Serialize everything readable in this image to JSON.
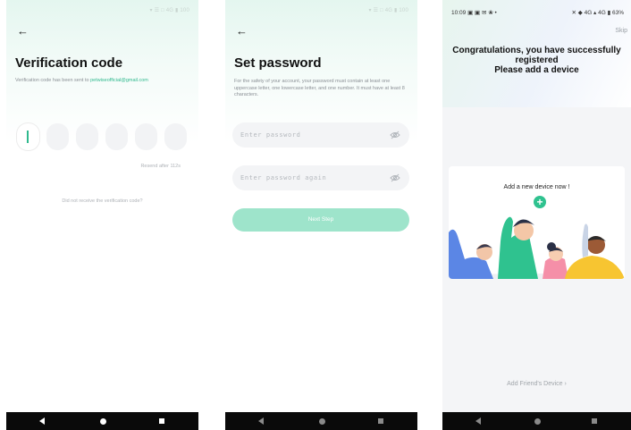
{
  "screen1": {
    "status_left": "",
    "status_right": "▾ ☰ □ 4G ▮ 100",
    "back_icon": "arrow-left-icon",
    "title": "Verification code",
    "subtitle_prefix": "Verification code has been sent to ",
    "email": "petwiseofficial@gmail.com",
    "code_boxes": 6,
    "resend": "Resend after 112s",
    "not_received": "Did not receive the verification code?",
    "accent": "#2fb98e"
  },
  "screen2": {
    "status_right": "▾ ☰ □ 4G ▮ 100",
    "back_icon": "arrow-left-icon",
    "title": "Set password",
    "description": "For the safety of your account, your password must contain at least one uppercase letter, one lowercase letter, and one number. It must have at least 8 characters.",
    "password_placeholder": "Enter password",
    "confirm_placeholder": "Enter password again",
    "next_button": "Next Step",
    "button_color": "#9ee4cb"
  },
  "screen3": {
    "status_time": "10:09",
    "status_left_icons": "▣ ▣ ✉ ❀ •",
    "status_right": "✕ ◆ 4G ▴ 4G ▮ 63%",
    "skip": "Skip",
    "congrats_line1": "Congratulations, you have successfully",
    "congrats_line2": "registered",
    "congrats_line3": "Please add a device",
    "add_device": "Add a new device now !",
    "add_friend": "Add Friend's Device ›",
    "accent": "#2fc28f"
  }
}
